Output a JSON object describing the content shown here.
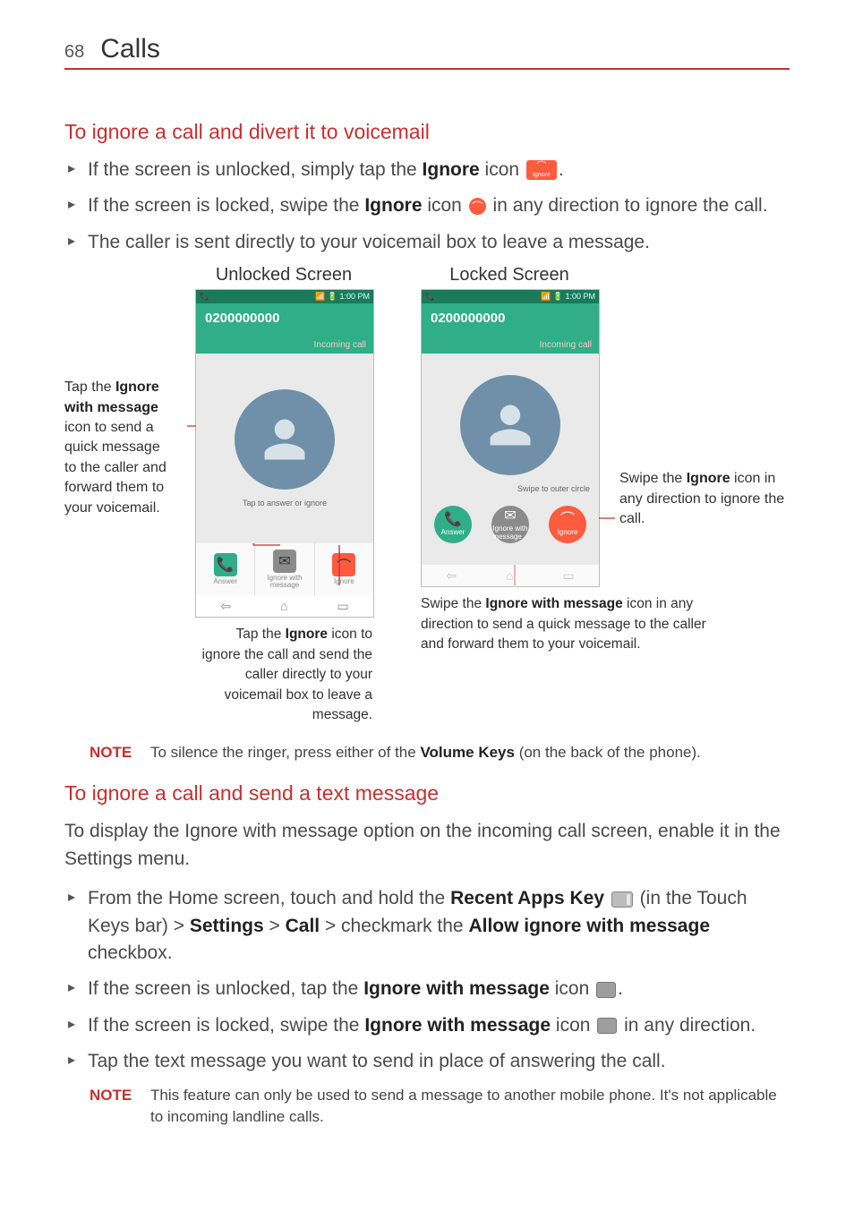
{
  "page": {
    "number": "68",
    "chapter": "Calls"
  },
  "section1": {
    "title": "To ignore a call and divert it to voicemail",
    "bullets": [
      {
        "pre": "If the screen is unlocked, simply tap the ",
        "b1": "Ignore",
        "post1": " icon ",
        "icon": "ignore-button",
        "post2": "."
      },
      {
        "pre": "If the screen is locked, swipe the ",
        "b1": "Ignore",
        "post1": " icon ",
        "icon": "ignore-circle",
        "post2": " in any direction to ignore the call."
      },
      {
        "text": "The caller is sent directly to your voicemail box to leave a message."
      }
    ]
  },
  "figures": {
    "left_title": "Unlocked Screen",
    "right_title": "Locked Screen",
    "status_time": "1:00 PM",
    "phone_number": "0200000000",
    "incoming_label": "Incoming call",
    "unlocked_hint": "Tap to answer or ignore",
    "locked_hint": "Swipe to outer circle",
    "buttons": {
      "answer": "Answer",
      "ignore_msg_line1": "Ignore with",
      "ignore_msg_line2": "message",
      "ignore": "Ignore"
    },
    "side_left": {
      "pre": "Tap the ",
      "b": "Ignore with message",
      "post": " icon to send a quick message to the caller and forward them to your voicemail."
    },
    "side_right": {
      "pre": "Swipe the ",
      "b": "Ignore",
      "post": " icon in any direction to ignore the call."
    },
    "under_left": {
      "pre": "Tap the ",
      "b": "Ignore",
      "post": " icon to ignore the call and send the caller directly to your voicemail box to leave a message."
    },
    "under_right": {
      "pre": "Swipe the ",
      "b": "Ignore with message",
      "post": " icon in any direction to send a quick message to the caller and forward them to your voicemail."
    }
  },
  "note1": {
    "label": "NOTE",
    "pre": "To silence the ringer, press either of the ",
    "b": "Volume Keys",
    "post": " (on the back of the phone)."
  },
  "section2": {
    "title": "To ignore a call and send a text message",
    "intro": "To display the Ignore with message option on the incoming call screen, enable it in the Settings menu.",
    "bullets": [
      {
        "seg": [
          {
            "t": "From the Home screen, touch and hold the "
          },
          {
            "b": "Recent Apps Key"
          },
          {
            "t": " "
          },
          {
            "icon": "recent"
          },
          {
            "t": " (in the Touch Keys bar) > "
          },
          {
            "b": "Settings"
          },
          {
            "t": " > "
          },
          {
            "b": "Call"
          },
          {
            "t": " > checkmark the "
          },
          {
            "b": "Allow ignore with message"
          },
          {
            "t": " checkbox."
          }
        ]
      },
      {
        "seg": [
          {
            "t": "If the screen is unlocked, tap the "
          },
          {
            "b": "Ignore with message"
          },
          {
            "t": " icon "
          },
          {
            "icon": "msg-box"
          },
          {
            "t": "."
          }
        ]
      },
      {
        "seg": [
          {
            "t": "If the screen is locked, swipe the "
          },
          {
            "b": "Ignore with message"
          },
          {
            "t": " icon "
          },
          {
            "icon": "msg-box"
          },
          {
            "t": " in any direction."
          }
        ]
      },
      {
        "seg": [
          {
            "t": "Tap the text message you want to send in place of answering the call."
          }
        ]
      }
    ]
  },
  "note2": {
    "label": "NOTE",
    "text": "This feature can only be used to send a message to another mobile phone. It's not applicable to incoming landline calls."
  }
}
